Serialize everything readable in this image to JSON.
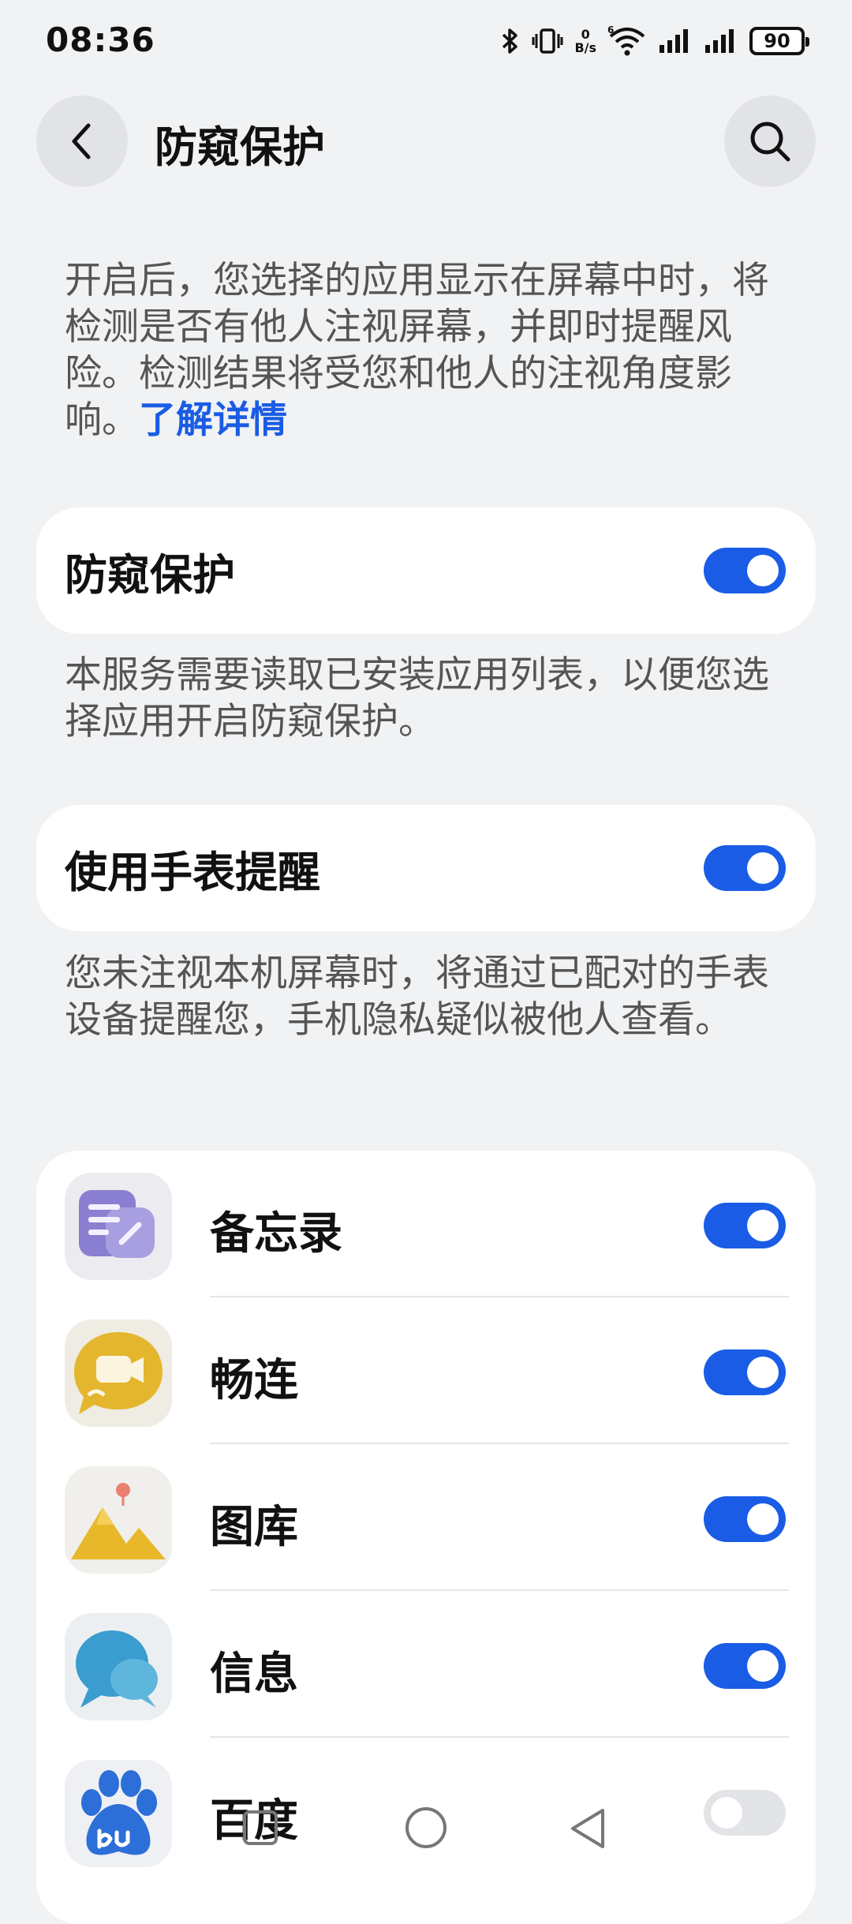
{
  "status_bar": {
    "time": "08:36",
    "net_speed_value": "0",
    "net_speed_unit": "B/s",
    "wifi_badge": "6",
    "battery": "90",
    "icons": [
      "bluetooth-icon",
      "vibrate-icon",
      "wifi-icon",
      "signal-icon",
      "signal-icon",
      "battery-icon"
    ]
  },
  "header": {
    "title": "防窥保护",
    "back_icon": "chevron-left-icon",
    "search_icon": "search-icon"
  },
  "intro": {
    "text": "开启后，您选择的应用显示在屏幕中时，将检测是否有他人注视屏幕，并即时提醒风险。检测结果将受您和他人的注视角度影响。",
    "link": "了解详情"
  },
  "privacy_card": {
    "label": "防窥保护",
    "enabled": true
  },
  "service_note": "本服务需要读取已安装应用列表，以便您选择应用开启防窥保护。",
  "watch_card": {
    "label": "使用手表提醒",
    "enabled": true
  },
  "watch_note": "您未注视本机屏幕时，将通过已配对的手表设备提醒您，手机隐私疑似被他人查看。",
  "apps": [
    {
      "name": "备忘录",
      "enabled": true,
      "icon": "notes-icon"
    },
    {
      "name": "畅连",
      "enabled": true,
      "icon": "meetime-icon"
    },
    {
      "name": "图库",
      "enabled": true,
      "icon": "gallery-icon"
    },
    {
      "name": "信息",
      "enabled": true,
      "icon": "messages-icon"
    },
    {
      "name": "百度",
      "enabled": false,
      "icon": "baidu-icon"
    }
  ],
  "colors": {
    "accent": "#1a5ce5",
    "background": "#f1f2f4",
    "card": "#ffffff"
  },
  "nav_bar": {
    "icons": [
      "recent-apps-icon",
      "home-icon",
      "back-icon"
    ]
  }
}
